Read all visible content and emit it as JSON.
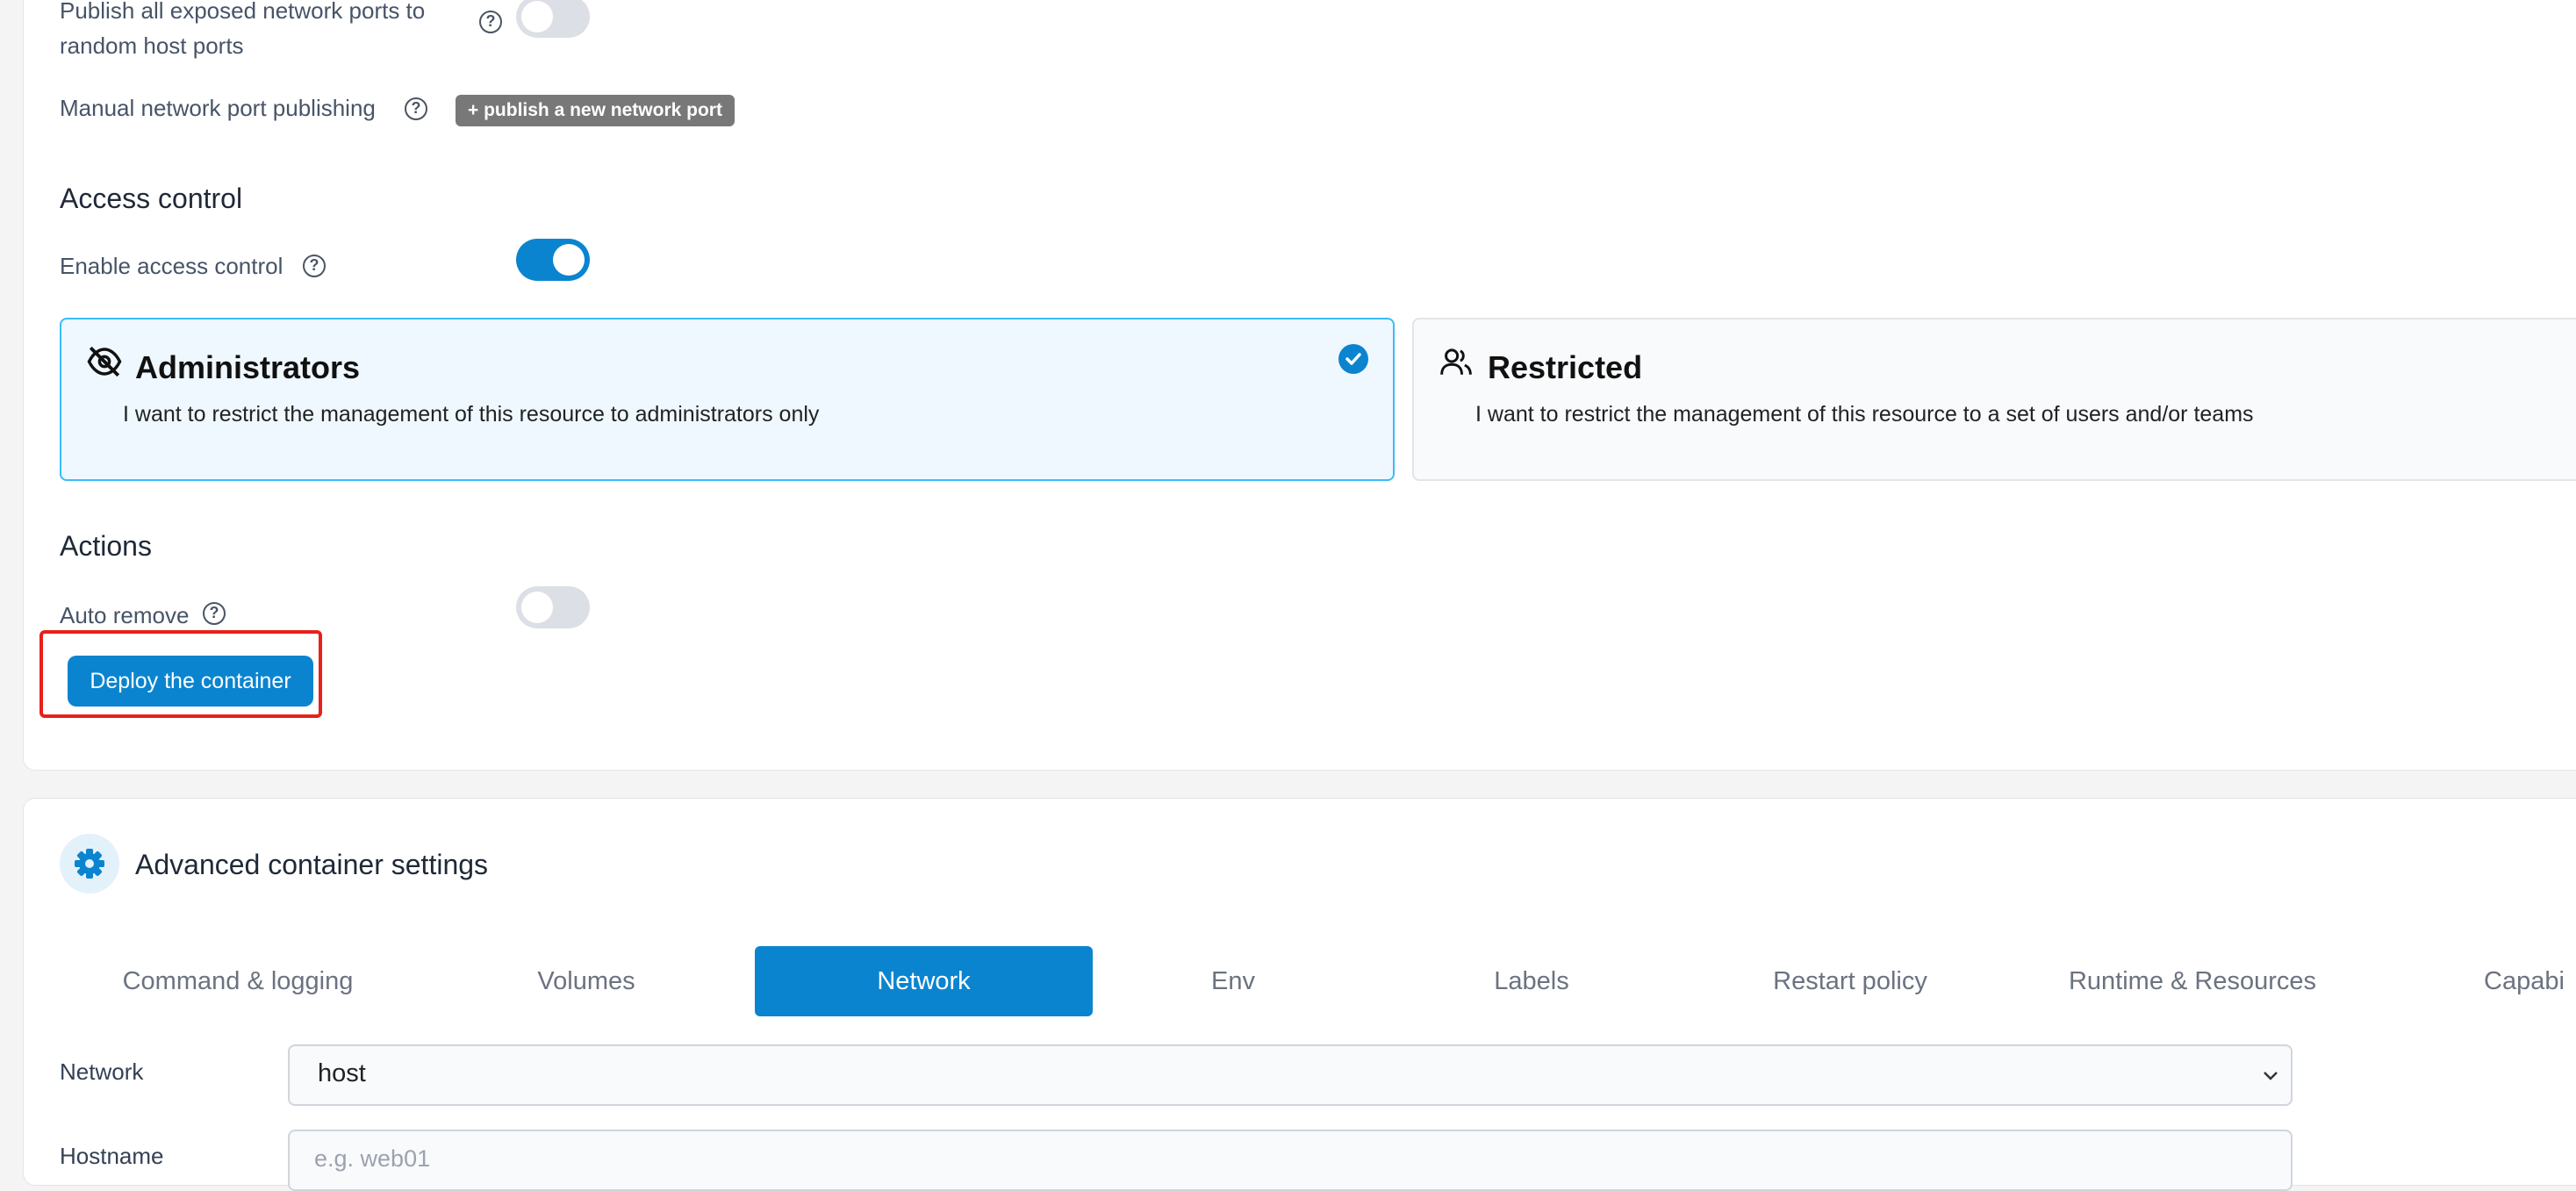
{
  "ports": {
    "publish_all_label_line1": "Publish all exposed network ports to",
    "publish_all_label_line2": "random host ports",
    "manual_label": "Manual network port publishing",
    "publish_new_button": "+ publish a new network port"
  },
  "access_control": {
    "title": "Access control",
    "enable_label": "Enable access control",
    "enabled": true,
    "cards": [
      {
        "title": "Administrators",
        "desc": "I want to restrict the management of this resource to administrators only",
        "selected": true
      },
      {
        "title": "Restricted",
        "desc": "I want to restrict the management of this resource to a set of users and/or teams",
        "selected": false
      }
    ]
  },
  "actions": {
    "title": "Actions",
    "auto_remove_label": "Auto remove",
    "auto_remove": false,
    "deploy_button": "Deploy the container"
  },
  "advanced": {
    "title": "Advanced container settings",
    "tabs": [
      "Command & logging",
      "Volumes",
      "Network",
      "Env",
      "Labels",
      "Restart policy",
      "Runtime & Resources",
      "Capabi"
    ],
    "active_tab": "Network",
    "network_label": "Network",
    "network_value": "host",
    "hostname_label": "Hostname",
    "hostname_placeholder": "e.g. web01"
  },
  "colors": {
    "accent": "#0b84d0",
    "highlight_box": "#e8201a",
    "selected_card_bg": "#eff8ff",
    "selected_card_border": "#38bdf8"
  }
}
